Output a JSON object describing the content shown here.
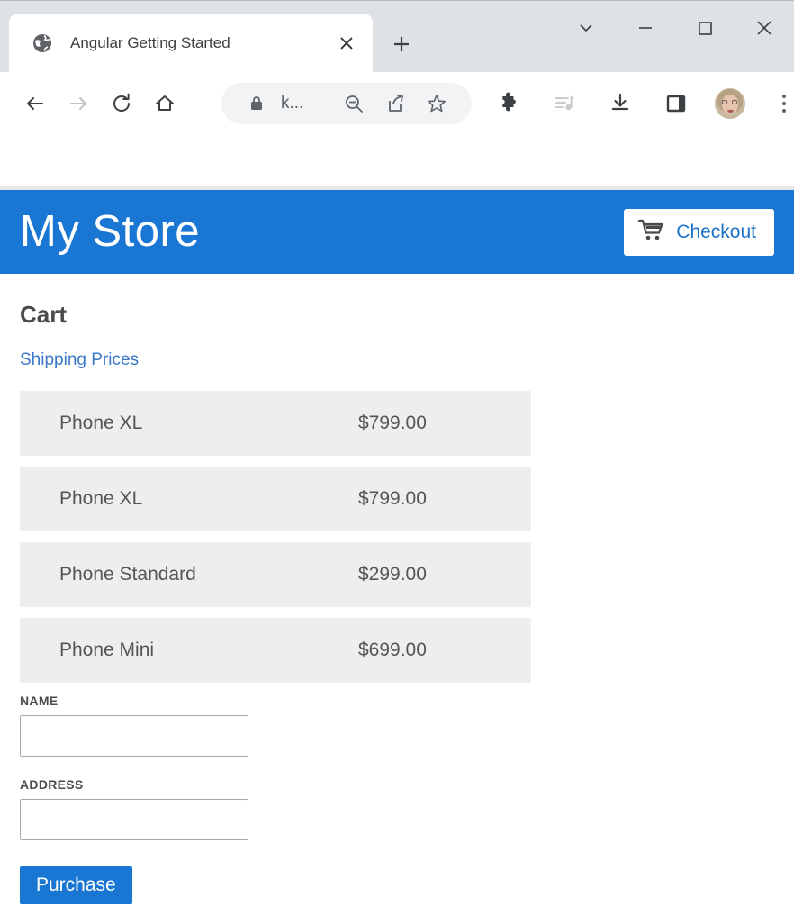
{
  "browser": {
    "tab": {
      "title": "Angular Getting Started",
      "favicon_name": "globe-icon",
      "close_name": "close-tab-icon"
    },
    "new_tab_label": "+",
    "window_controls": {
      "tab_search": "tab-search-chevron",
      "minimize": "minimize",
      "maximize": "maximize",
      "close": "close"
    },
    "toolbar": {
      "back": "back-arrow",
      "forward": "forward-arrow",
      "reload": "reload",
      "home": "home",
      "lock": "lock-icon",
      "url_text": "k...",
      "zoom_out": "zoom-out-icon",
      "share": "share-icon",
      "bookmark": "star-icon",
      "extensions": "puzzle-icon",
      "media": "media-playlist-icon",
      "downloads": "download-icon",
      "side_panel": "side-panel-icon",
      "profile": "profile-avatar",
      "menu": "three-dot-menu"
    }
  },
  "page": {
    "store_title": "My Store",
    "checkout_label": "Checkout",
    "checkout_icon": "shopping-cart-icon",
    "heading": "Cart",
    "shipping_link": "Shipping Prices",
    "cart_items": [
      {
        "name": "Phone XL",
        "price": "$799.00"
      },
      {
        "name": "Phone XL",
        "price": "$799.00"
      },
      {
        "name": "Phone Standard",
        "price": "$299.00"
      },
      {
        "name": "Phone Mini",
        "price": "$699.00"
      }
    ],
    "form": {
      "name_label": "NAME",
      "name_value": "",
      "address_label": "ADDRESS",
      "address_value": "",
      "purchase_label": "Purchase"
    }
  },
  "colors": {
    "brand_blue": "#1976d2",
    "link_blue": "#3b78c9",
    "row_gray": "#eeeeee",
    "tabstrip_gray": "#dee1e6"
  }
}
